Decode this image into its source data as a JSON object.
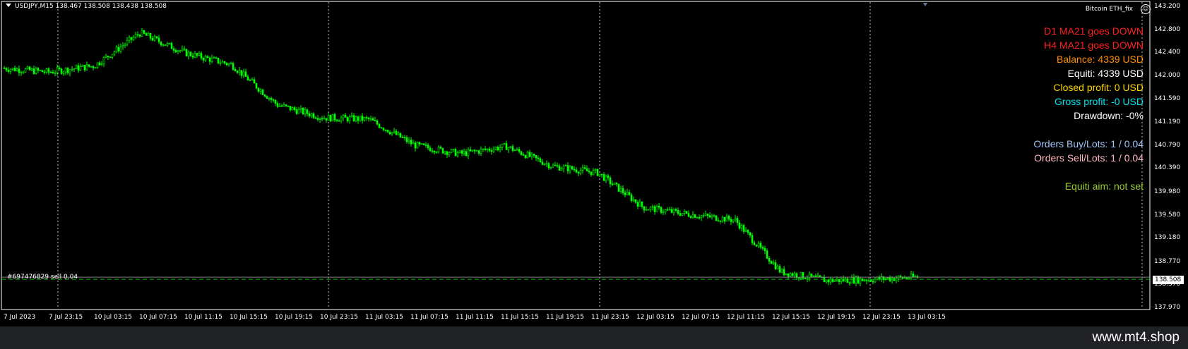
{
  "window": {
    "symbol_header": "USDJPY,M15  138.467 138.508 138.438 138.508",
    "ea_name": "Bitcoin ETH_fix",
    "ea_status_icon": "smiley-icon"
  },
  "info_panel": [
    {
      "text": "D1 MA21 goes DOWN",
      "color": "#ff2020"
    },
    {
      "text": "H4 MA21 goes DOWN",
      "color": "#ff2020"
    },
    {
      "text": "Balance: 4339 USD",
      "color": "#ff8c00"
    },
    {
      "text": "Equiti: 4339 USD",
      "color": "#ffffff"
    },
    {
      "text": "Closed profit: 0 USD",
      "color": "#ffd700"
    },
    {
      "text": "Gross profit: -0 USD",
      "color": "#00e5ee"
    },
    {
      "text": "Drawdown: -0%",
      "color": "#ffffff"
    },
    {
      "text": "",
      "color": "#ffffff"
    },
    {
      "text": "Orders Buy/Lots: 1 / 0.04",
      "color": "#9fc5f8"
    },
    {
      "text": "Orders Sell/Lots: 1 / 0.04",
      "color": "#ffb6c1"
    },
    {
      "text": "",
      "color": "#ffffff"
    },
    {
      "text": "Equiti aim: not set",
      "color": "#9acd32"
    }
  ],
  "price_axis": [
    "143.200",
    "142.800",
    "142.400",
    "142.000",
    "141.590",
    "141.190",
    "140.790",
    "140.390",
    "139.980",
    "139.580",
    "139.180",
    "138.770",
    "138.370",
    "137.970"
  ],
  "time_axis": [
    "7 Jul 2023",
    "7 Jul 23:15",
    "10 Jul 03:15",
    "10 Jul 07:15",
    "10 Jul 11:15",
    "10 Jul 15:15",
    "10 Jul 19:15",
    "10 Jul 23:15",
    "11 Jul 03:15",
    "11 Jul 07:15",
    "11 Jul 11:15",
    "11 Jul 15:15",
    "11 Jul 19:15",
    "11 Jul 23:15",
    "12 Jul 03:15",
    "12 Jul 07:15",
    "12 Jul 11:15",
    "12 Jul 15:15",
    "12 Jul 19:15",
    "12 Jul 23:15",
    "13 Jul 03:15"
  ],
  "order_line_label": "#697476829 sell 0.04",
  "bid_price": "138.508",
  "colors": {
    "candles": "#00ff00",
    "grid": "#c8c8c8",
    "order_line": "#00c000",
    "bid_line": "#808080"
  },
  "chart_data": {
    "type": "line",
    "symbol": "USDJPY",
    "timeframe": "M15",
    "ylim": [
      137.97,
      143.2
    ],
    "x": [
      "7 Jul 2023",
      "7 Jul 23:15",
      "10 Jul 03:15",
      "10 Jul 07:15",
      "10 Jul 11:15",
      "10 Jul 15:15",
      "10 Jul 19:15",
      "10 Jul 23:15",
      "11 Jul 03:15",
      "11 Jul 07:15",
      "11 Jul 11:15",
      "11 Jul 15:15",
      "11 Jul 19:15",
      "11 Jul 23:15",
      "12 Jul 03:15",
      "12 Jul 07:15",
      "12 Jul 11:15",
      "12 Jul 15:15",
      "12 Jul 19:15",
      "12 Jul 23:15",
      "13 Jul 03:15"
    ],
    "series": [
      {
        "values": [
          142.14,
          142.07,
          142.18,
          142.75,
          142.4,
          142.2,
          141.5,
          141.28,
          141.25,
          140.8,
          140.65,
          140.78,
          140.44,
          140.32,
          139.72,
          139.6,
          139.5,
          138.6,
          138.45,
          138.47,
          138.51
        ]
      }
    ],
    "reference_lines": {
      "order_sell": 138.47,
      "bid": 138.508
    },
    "grid": true
  }
}
